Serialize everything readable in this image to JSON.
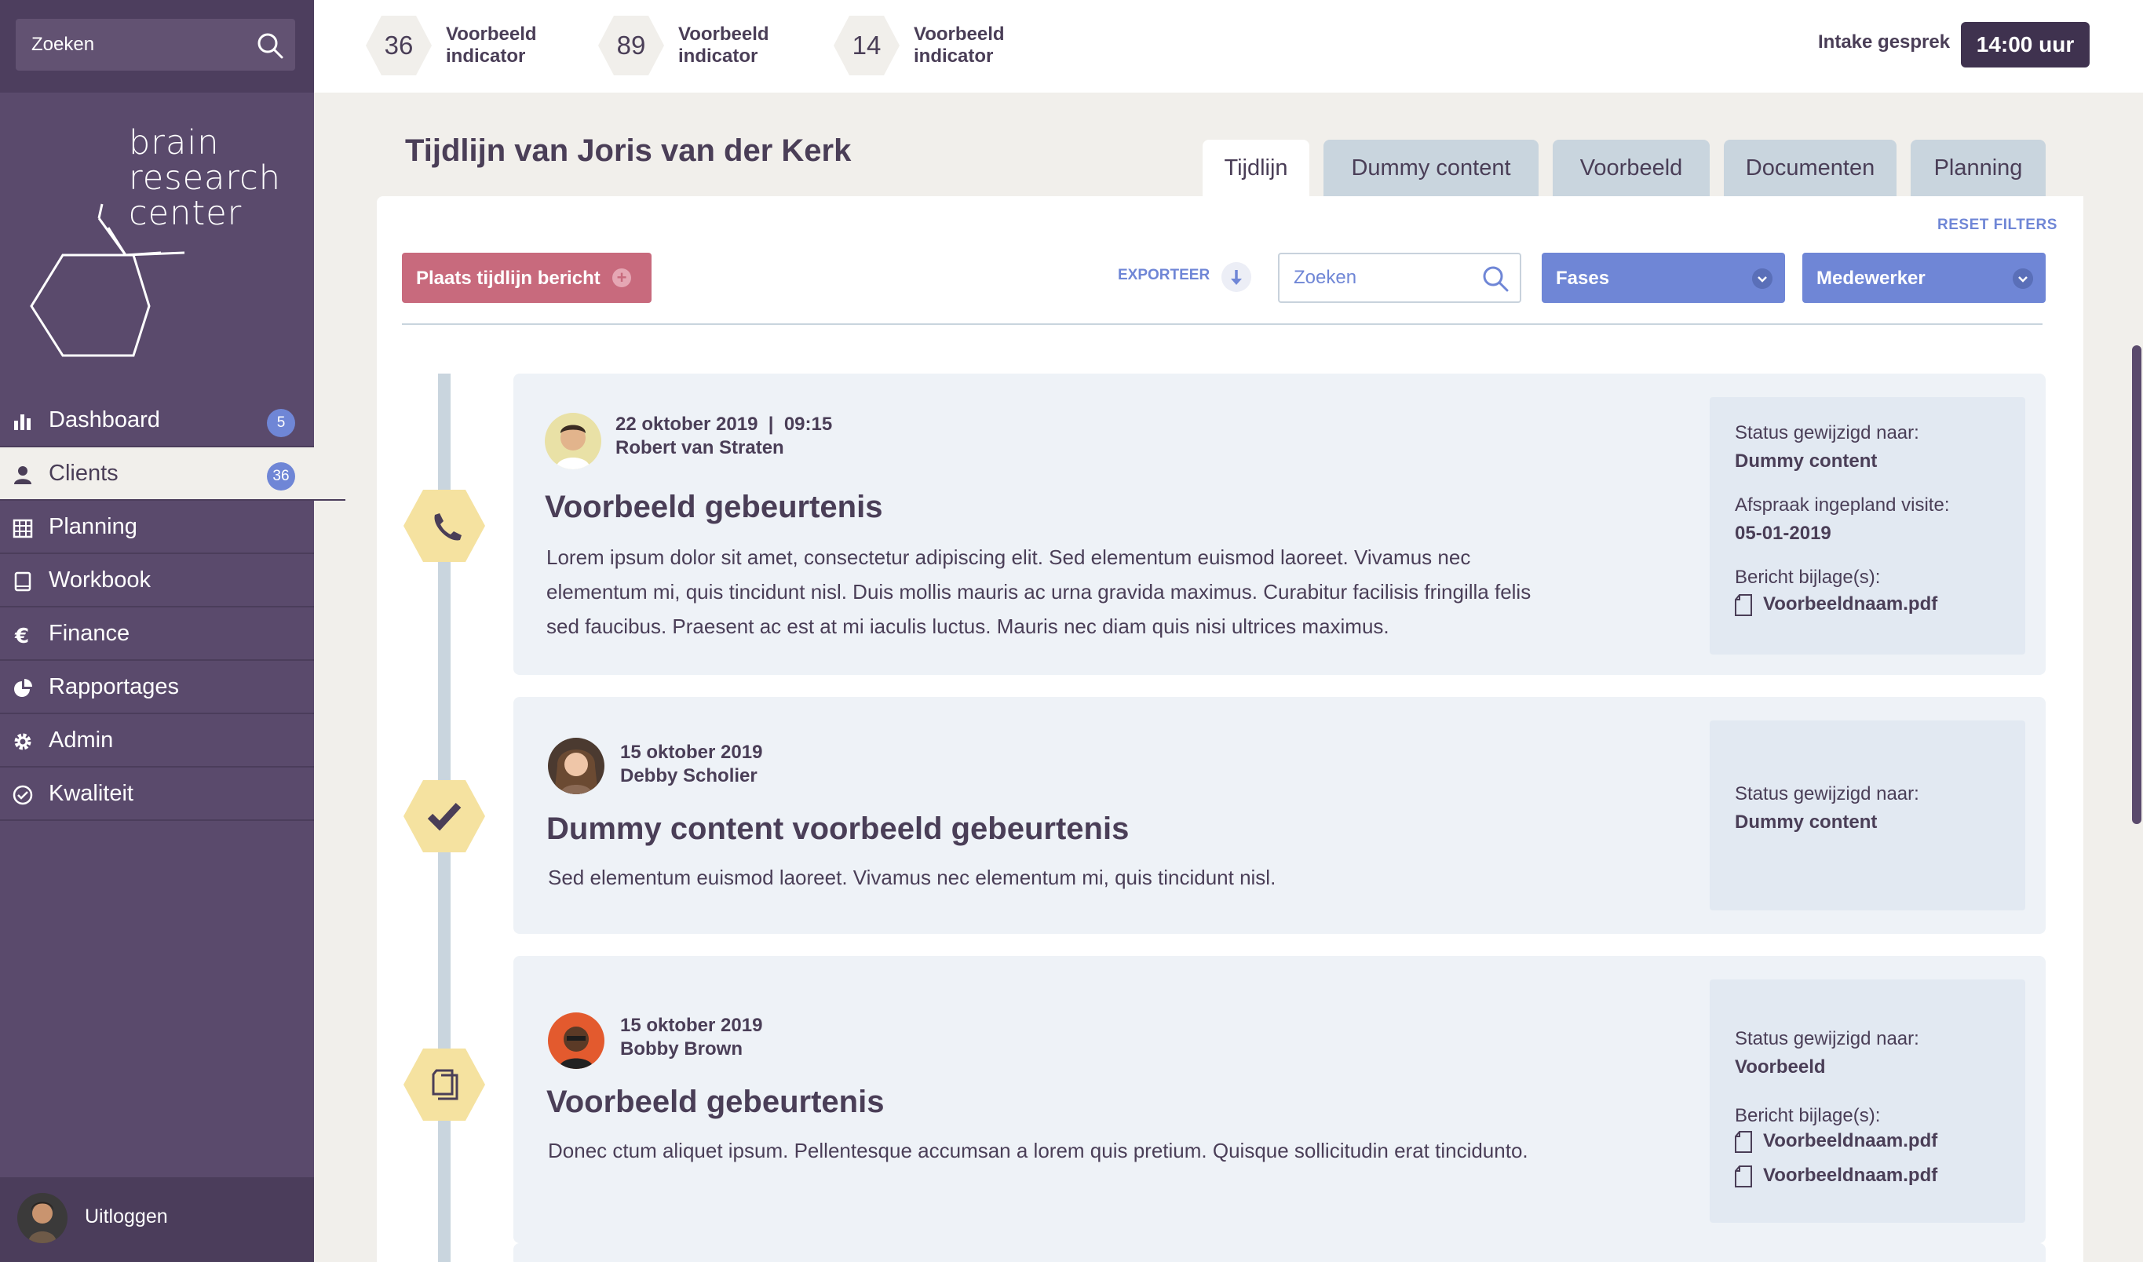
{
  "sidebar": {
    "search_placeholder": "Zoeken",
    "logo_text": [
      "brain",
      "research",
      "center"
    ],
    "nav": [
      {
        "label": "Dashboard",
        "icon": "bar-chart-icon",
        "badge": "5"
      },
      {
        "label": "Clients",
        "icon": "user-icon",
        "badge": "36",
        "active": true
      },
      {
        "label": "Planning",
        "icon": "calendar-icon"
      },
      {
        "label": "Workbook",
        "icon": "book-icon"
      },
      {
        "label": "Finance",
        "icon": "euro-icon"
      },
      {
        "label": "Rapportages",
        "icon": "pie-chart-icon"
      },
      {
        "label": "Admin",
        "icon": "gear-icon"
      },
      {
        "label": "Kwaliteit",
        "icon": "check-circle-icon"
      }
    ],
    "logout_label": "Uitloggen"
  },
  "topbar": {
    "indicators": [
      {
        "value": "36",
        "label": "Voorbeeld indicator"
      },
      {
        "value": "89",
        "label": "Voorbeeld indicator"
      },
      {
        "value": "14",
        "label": "Voorbeeld indicator"
      }
    ],
    "intake_label": "Intake gesprek",
    "time": "14:00 uur"
  },
  "page": {
    "title": "Tijdlijn van Joris van der Kerk",
    "tabs": [
      "Tijdlijn",
      "Dummy content",
      "Voorbeeld",
      "Documenten",
      "Planning"
    ],
    "active_tab": "Tijdlijn"
  },
  "toolbar": {
    "reset_filters": "RESET FILTERS",
    "post_button": "Plaats tijdlijn bericht",
    "export": "EXPORTEER",
    "search_placeholder": "Zoeken",
    "phases_dropdown": "Fases",
    "employee_dropdown": "Medewerker"
  },
  "events": [
    {
      "icon": "phone-icon",
      "date": "22 oktober 2019  |  09:15",
      "author": "Robert van Straten",
      "title": "Voorbeeld gebeurtenis",
      "body": "Lorem ipsum dolor sit amet, consectetur adipiscing elit. Sed elementum euismod laoreet. Vivamus nec elementum mi, quis tincidunt nisl. Duis mollis mauris ac urna gravida maximus. Curabitur facilisis fringilla felis sed faucibus. Praesent ac est at mi iaculis luctus. Mauris nec diam quis nisi ultrices maximus.",
      "status_label": "Status gewijzigd naar:",
      "status_value": "Dummy content",
      "appointment_label": "Afspraak ingepland visite:",
      "appointment_value": "05-01-2019",
      "attachments_label": "Bericht bijlage(s):",
      "attachments": [
        "Voorbeeldnaam.pdf"
      ]
    },
    {
      "icon": "checkmark-icon",
      "date": "15 oktober 2019",
      "author": "Debby Scholier",
      "title": "Dummy content voorbeeld gebeurtenis",
      "body": "Sed elementum euismod laoreet. Vivamus nec elementum mi, quis tincidunt nisl.",
      "status_label": "Status gewijzigd naar:",
      "status_value": "Dummy content"
    },
    {
      "icon": "documents-icon",
      "date": "15 oktober 2019",
      "author": "Bobby Brown",
      "title": "Voorbeeld gebeurtenis",
      "body": "Donec ctum aliquet ipsum. Pellentesque accumsan a lorem quis pretium. Quisque sollicitudin erat tincidunto.",
      "status_label": "Status gewijzigd naar:",
      "status_value": "Voorbeeld",
      "attachments_label": "Bericht bijlage(s):",
      "attachments": [
        "Voorbeeldnaam.pdf",
        "Voorbeeldnaam.pdf"
      ]
    }
  ],
  "colors": {
    "sidebar": "#5a4a6c",
    "accent_blue": "#6f86d6",
    "accent_pink": "#c86a7d",
    "hex_yellow": "#f5e2a0",
    "timeline_line": "#c9d5de"
  }
}
